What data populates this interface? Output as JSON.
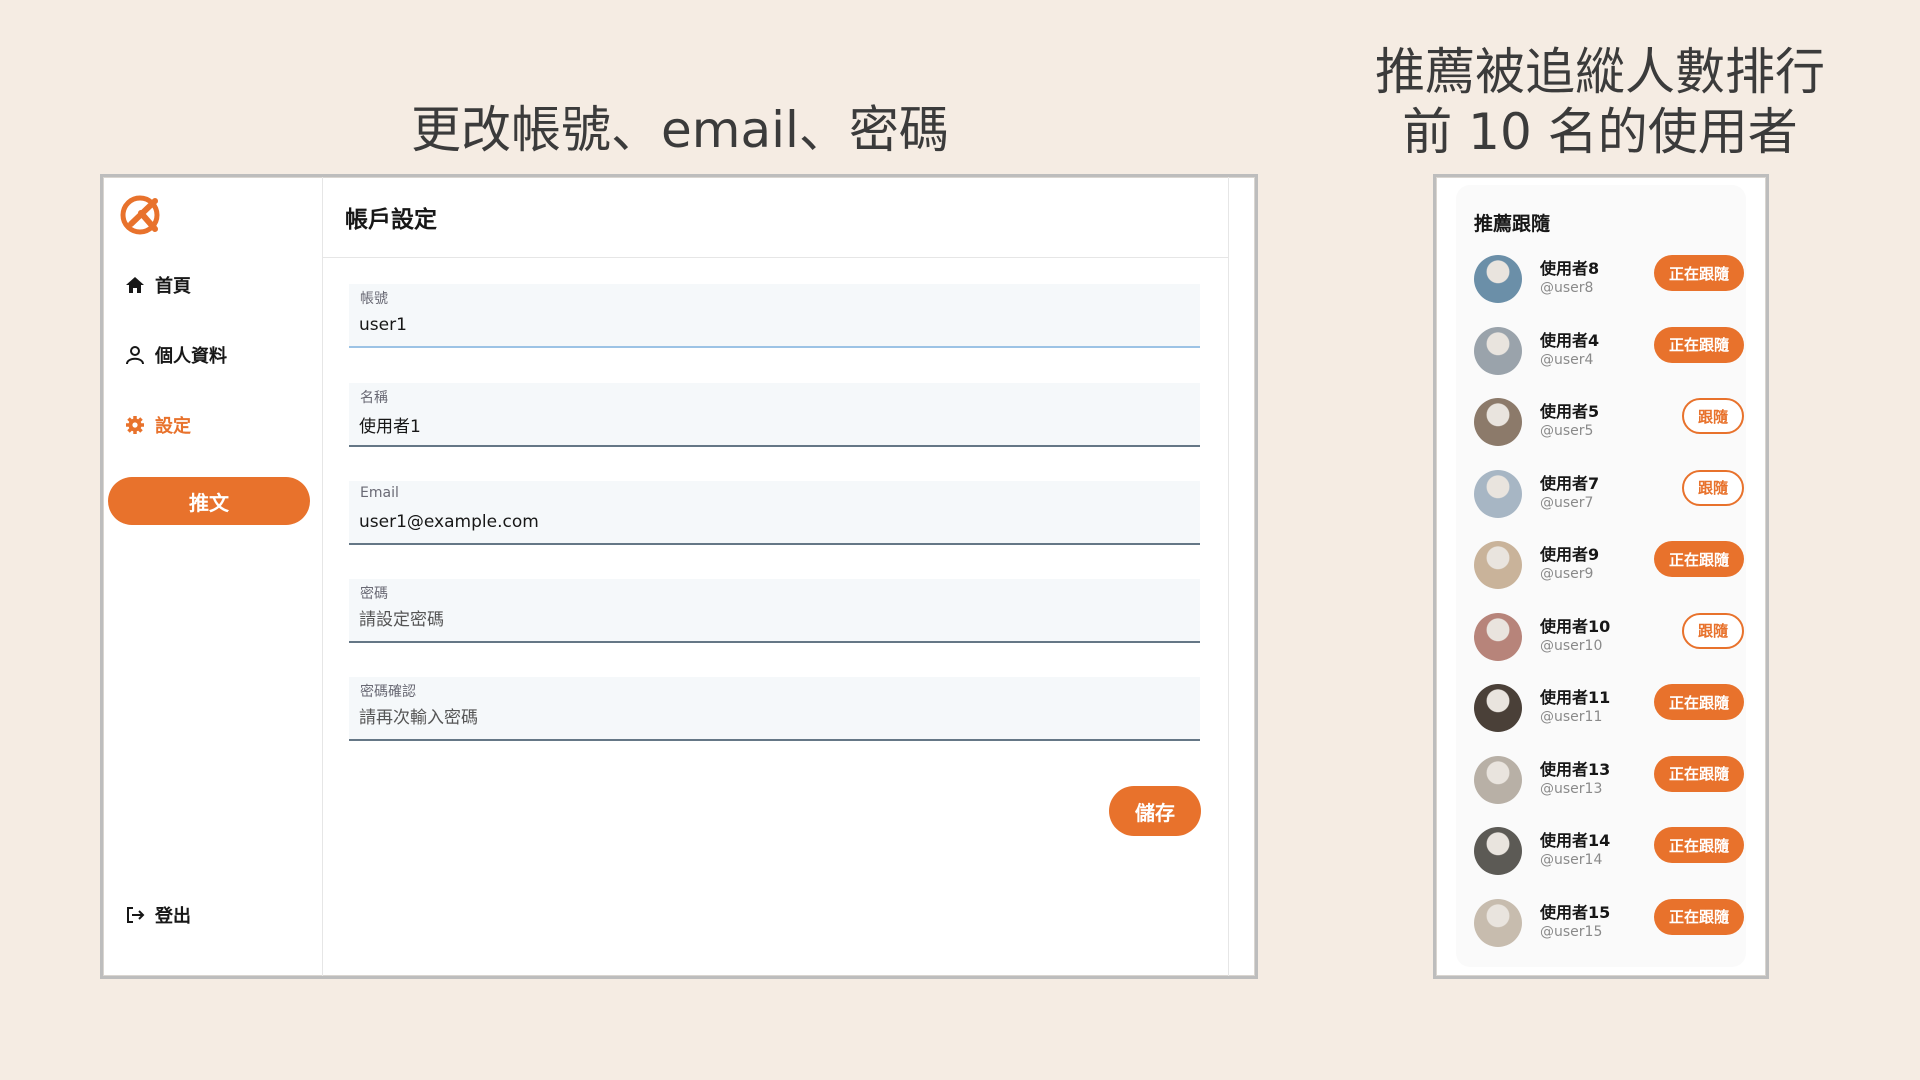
{
  "headings": {
    "left": "更改帳號、email、密碼",
    "right_line1": "推薦被追縱人數排行",
    "right_line2": "前 10 名的使用者"
  },
  "colors": {
    "accent": "#e8722c",
    "background": "#f5ece3"
  },
  "sidebar": {
    "logo": "alpha-logo-icon",
    "items": [
      {
        "label": "首頁",
        "icon": "home-icon"
      },
      {
        "label": "個人資料",
        "icon": "user-icon"
      },
      {
        "label": "設定",
        "icon": "gear-icon",
        "active": true
      }
    ],
    "tweet_button": "推文",
    "logout": {
      "label": "登出",
      "icon": "logout-icon"
    }
  },
  "main": {
    "title": "帳戶設定",
    "fields": {
      "account": {
        "label": "帳號",
        "value": "user1",
        "placeholder": ""
      },
      "name": {
        "label": "名稱",
        "value": "使用者1",
        "placeholder": ""
      },
      "email": {
        "label": "Email",
        "value": "user1@example.com",
        "placeholder": ""
      },
      "password": {
        "label": "密碼",
        "value": "",
        "placeholder": "請設定密碼"
      },
      "confirm": {
        "label": "密碼確認",
        "value": "",
        "placeholder": "請再次輸入密碼"
      }
    },
    "save_button": "儲存"
  },
  "recommend": {
    "title": "推薦跟隨",
    "users": [
      {
        "name": "使用者8",
        "handle": "@user8",
        "button": "正在跟隨",
        "following": true
      },
      {
        "name": "使用者4",
        "handle": "@user4",
        "button": "正在跟隨",
        "following": true
      },
      {
        "name": "使用者5",
        "handle": "@user5",
        "button": "跟隨",
        "following": false
      },
      {
        "name": "使用者7",
        "handle": "@user7",
        "button": "跟隨",
        "following": false
      },
      {
        "name": "使用者9",
        "handle": "@user9",
        "button": "正在跟隨",
        "following": true
      },
      {
        "name": "使用者10",
        "handle": "@user10",
        "button": "跟隨",
        "following": false
      },
      {
        "name": "使用者11",
        "handle": "@user11",
        "button": "正在跟隨",
        "following": true
      },
      {
        "name": "使用者13",
        "handle": "@user13",
        "button": "正在跟隨",
        "following": true
      },
      {
        "name": "使用者14",
        "handle": "@user14",
        "button": "正在跟隨",
        "following": true
      },
      {
        "name": "使用者15",
        "handle": "@user15",
        "button": "正在跟隨",
        "following": true
      }
    ]
  }
}
